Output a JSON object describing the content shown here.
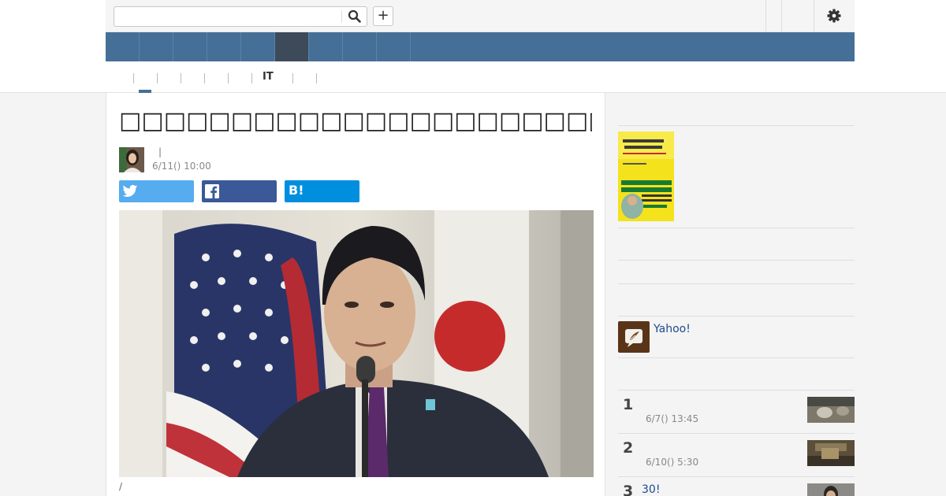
{
  "toolbar": {
    "search_value": "",
    "search_icon": "search-icon",
    "add_label": "+",
    "settings_icon": "gear-icon"
  },
  "subnav": {
    "it_label": "IT"
  },
  "article": {
    "headline": "□□□□□□□□□□□□□□□□□□□□□□□□□□□□□□□□□□□□□□□",
    "byline_separator": "|",
    "date": "6/11() 10:00",
    "share": {
      "twitter_color": "#55acee",
      "facebook_color": "#3b5998",
      "hatena_label": "B!",
      "hatena_color": "#008fde"
    },
    "caption": "/"
  },
  "sidebar": {
    "yahoo_label": "Yahoo!",
    "ranking": [
      {
        "rank": "1",
        "title": "",
        "time": "6/7() 13:45"
      },
      {
        "rank": "2",
        "title": "",
        "time": "6/10() 5:30"
      },
      {
        "rank": "3",
        "title": "30!",
        "time": ""
      }
    ]
  },
  "colors": {
    "nav_bar": "#456f97",
    "nav_active": "#3d4a5a",
    "link": "#1d4a8c"
  }
}
